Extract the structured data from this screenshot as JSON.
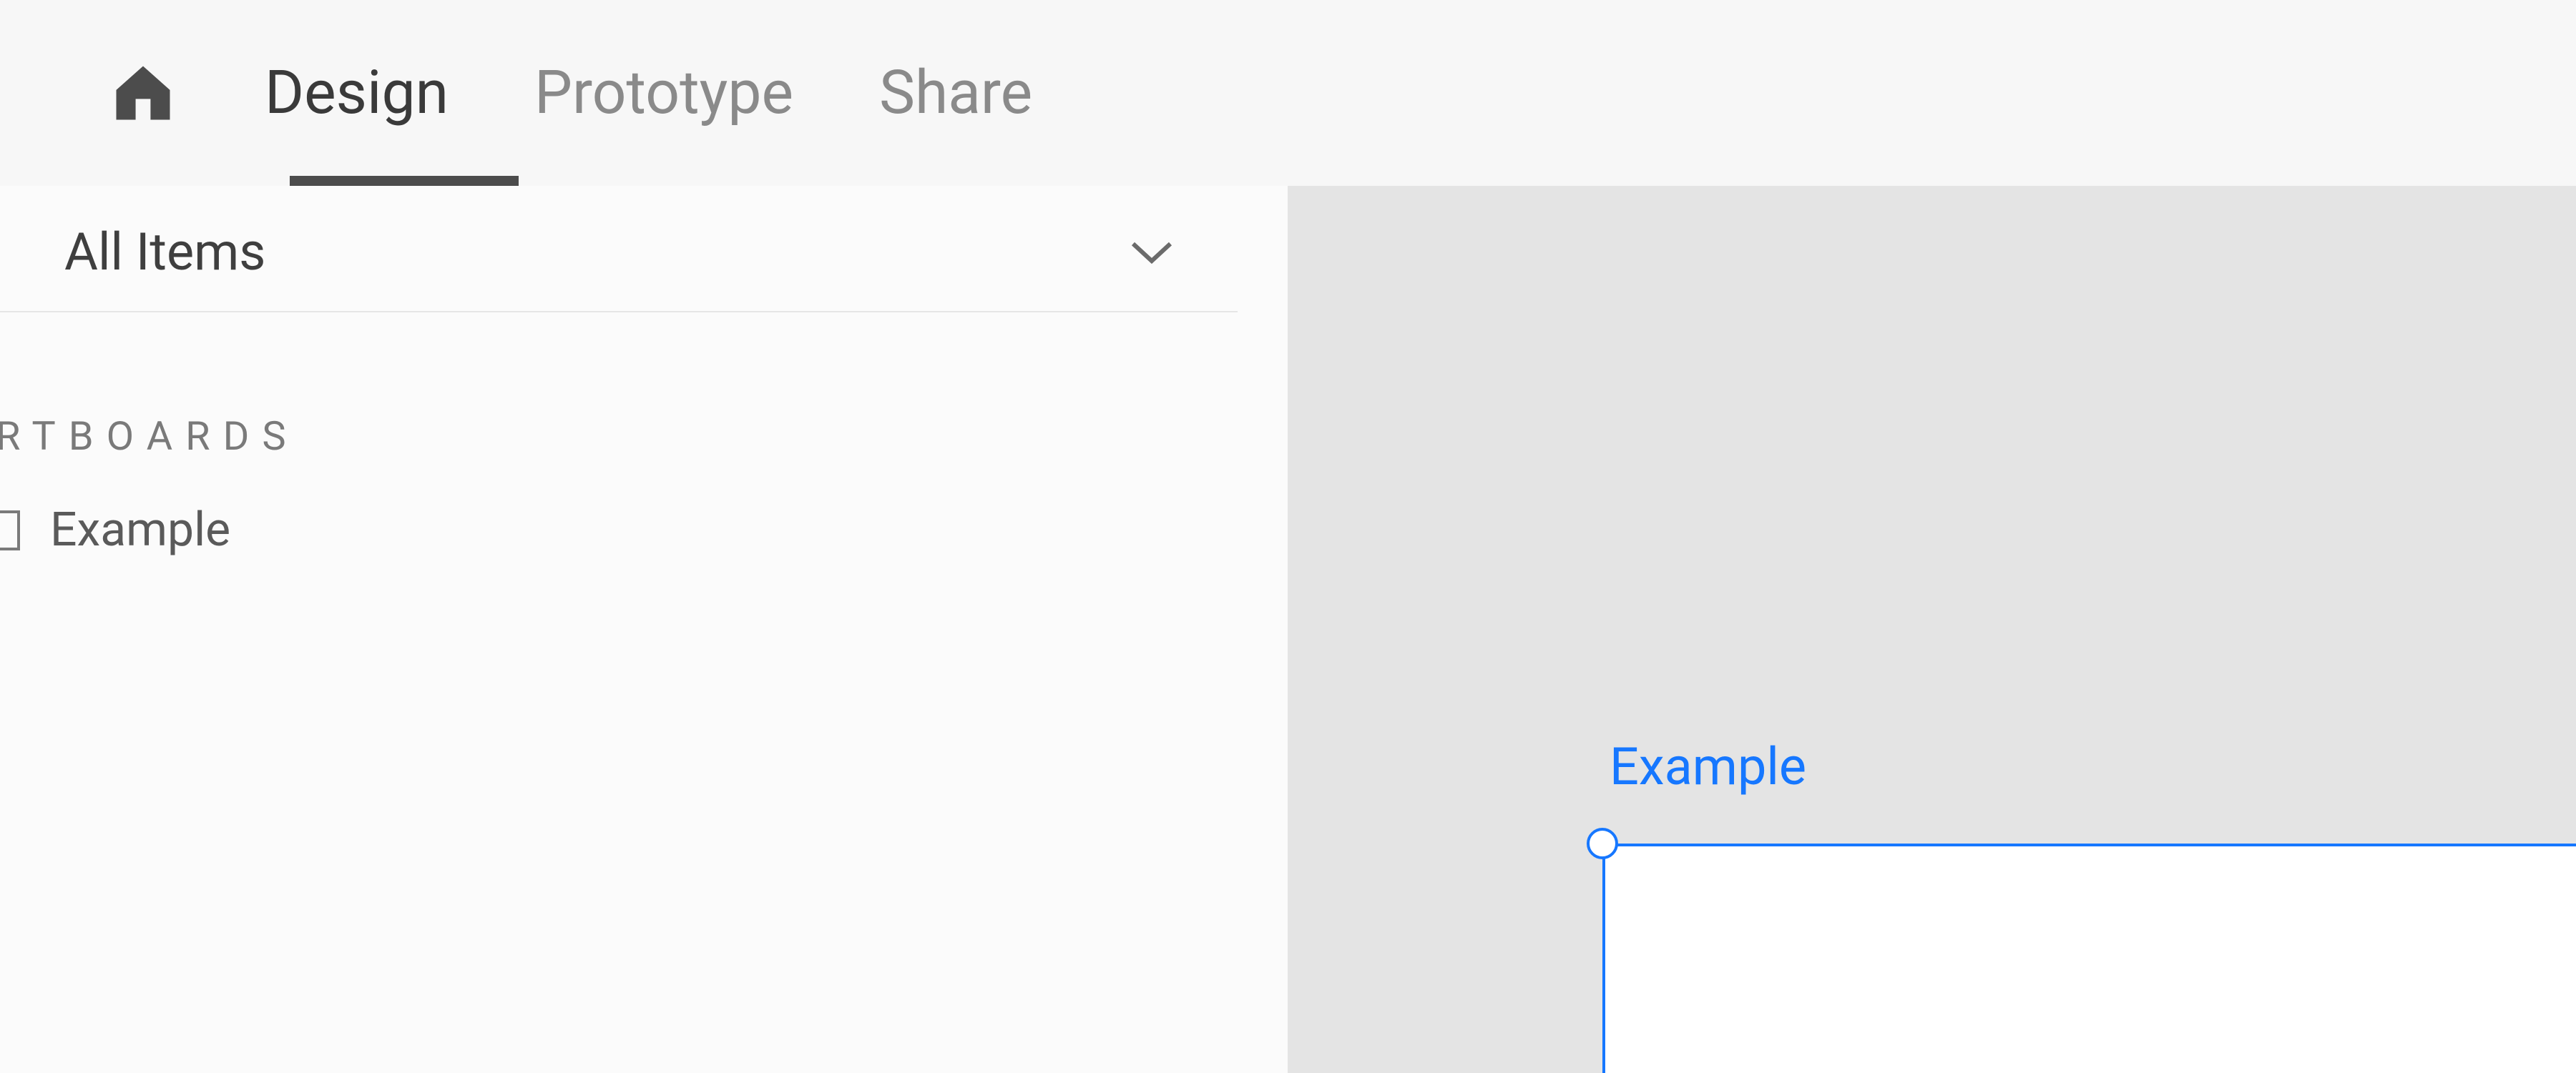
{
  "topnav": {
    "tabs": {
      "design": "Design",
      "prototype": "Prototype",
      "share": "Share"
    }
  },
  "sidebar": {
    "filter_label": "All Items",
    "section_heading": "RTBOARDS",
    "layers": [
      {
        "name": "Example"
      }
    ]
  },
  "canvas": {
    "artboard_title": "Example"
  }
}
